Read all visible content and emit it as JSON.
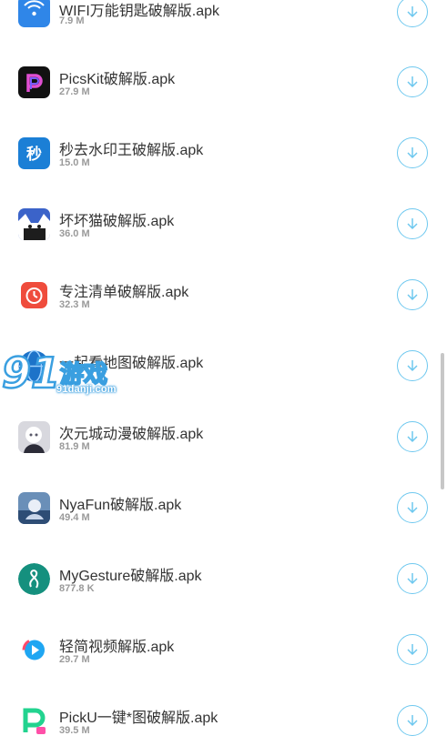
{
  "colors": {
    "accent": "#6ec8ef",
    "text": "#333333",
    "muted": "#9a9a9a",
    "watermark": "#3a9fe0"
  },
  "apps": [
    {
      "name": "WIFI万能钥匙破解版.apk",
      "size": "7.9 M",
      "icon": "wifi-key-icon"
    },
    {
      "name": "PicsKit破解版.apk",
      "size": "27.9 M",
      "icon": "picskit-icon"
    },
    {
      "name": "秒去水印王破解版.apk",
      "size": "15.0 M",
      "icon": "watermark-remover-icon"
    },
    {
      "name": "坏坏猫破解版.apk",
      "size": "36.0 M",
      "icon": "bad-cat-icon"
    },
    {
      "name": "专注清单破解版.apk",
      "size": "32.3 M",
      "icon": "focus-list-icon"
    },
    {
      "name": "一起看地图破解版.apk",
      "size": "",
      "icon": "map-globe-icon"
    },
    {
      "name": "次元城动漫破解版.apk",
      "size": "81.9 M",
      "icon": "anime-city-icon"
    },
    {
      "name": "NyaFun破解版.apk",
      "size": "49.4 M",
      "icon": "nyafun-icon"
    },
    {
      "name": "MyGesture破解版.apk",
      "size": "877.8 K",
      "icon": "mygesture-icon"
    },
    {
      "name": "轻简视频解版.apk",
      "size": "29.7 M",
      "icon": "light-video-icon"
    },
    {
      "name": "PickU一键*图破解版.apk",
      "size": "39.5 M",
      "icon": "picku-icon"
    }
  ],
  "watermark": {
    "logo_text": "91",
    "brand_text": "游戏",
    "url": "91danji.com"
  }
}
